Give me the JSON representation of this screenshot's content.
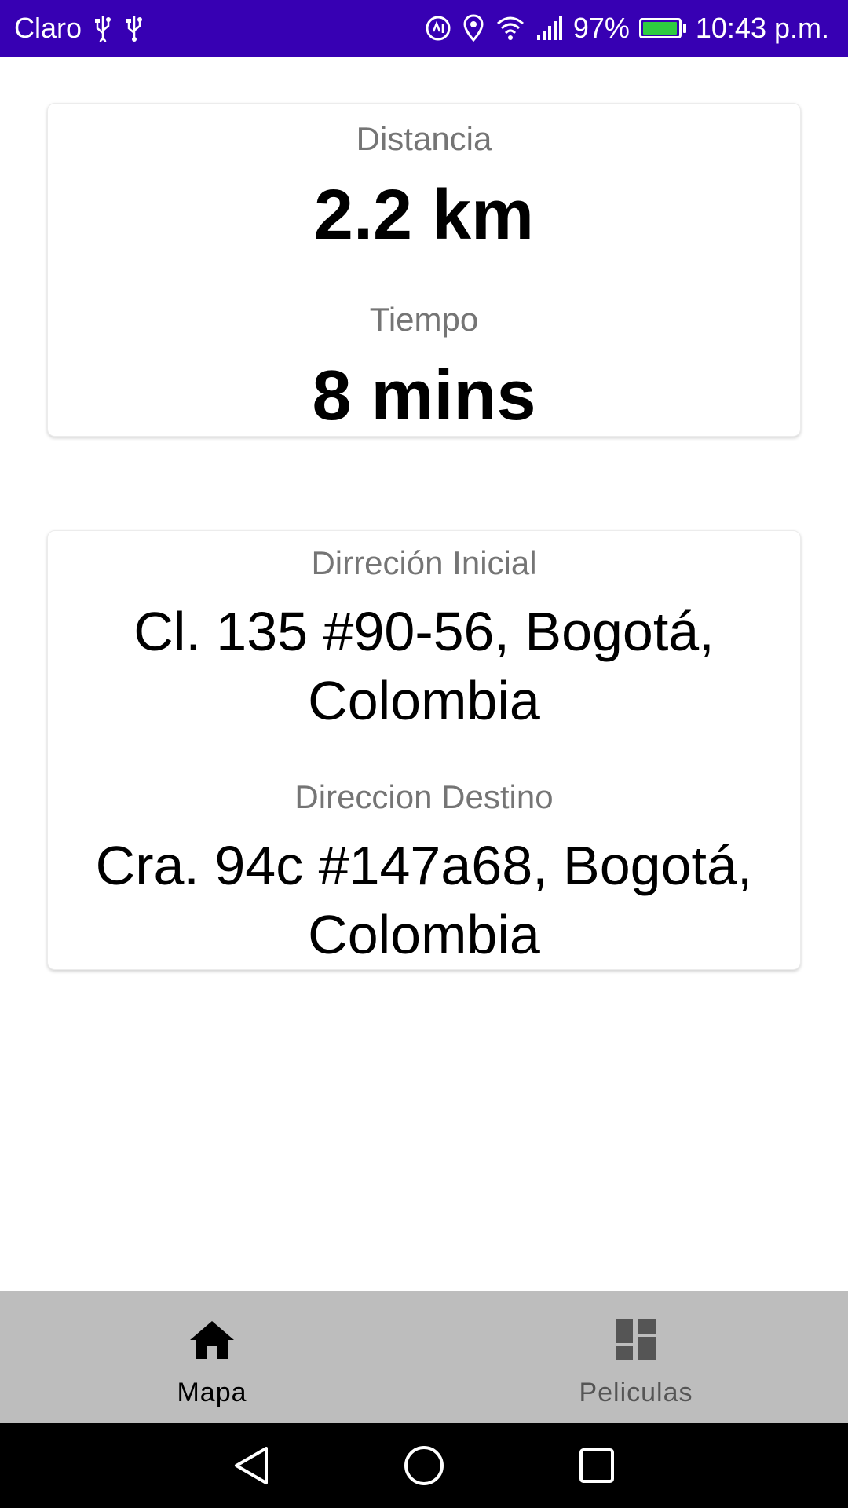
{
  "status_bar": {
    "carrier": "Claro",
    "battery_percent": "97%",
    "battery_level": 0.97,
    "time": "10:43 p.m.",
    "icons": [
      "usb-icon",
      "usb-icon",
      "data-saver-icon",
      "location-icon",
      "wifi-icon",
      "signal-icon",
      "battery-icon"
    ]
  },
  "trip_summary": {
    "distance_label": "Distancia",
    "distance_value": "2.2 km",
    "time_label": "Tiempo",
    "time_value": "8 mins"
  },
  "addresses": {
    "start_label": "Dirreción Inicial",
    "start_value": "Cl. 135 #90-56, Bogotá, Colombia",
    "destination_label": "Direccion Destino",
    "destination_value": "Cra. 94c #147a68, Bogotá, Colombia"
  },
  "bottom_nav": {
    "items": [
      {
        "label": "Mapa",
        "icon": "home-icon",
        "active": true
      },
      {
        "label": "Peliculas",
        "icon": "dashboard-icon",
        "active": false
      }
    ]
  },
  "system_nav": {
    "icons": [
      "back-icon",
      "home-circle-icon",
      "recents-icon"
    ]
  },
  "colors": {
    "status_bar": "#3700b3",
    "bottom_nav": "#bdbdbd",
    "label_gray": "#757575",
    "battery_fill": "#2ecc40"
  }
}
